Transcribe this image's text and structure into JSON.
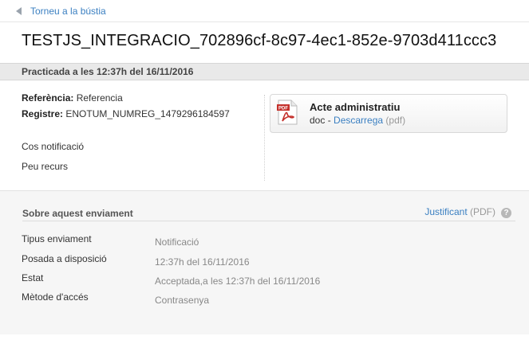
{
  "nav": {
    "back_label": "Torneu a la bústia"
  },
  "notification": {
    "title": "TESTJS_INTEGRACIO_702896cf-8c97-4ec1-852e-9703d411ccc3",
    "practicada": "Practicada a les 12:37h del 16/11/2016"
  },
  "details": {
    "referencia_label": "Referència:",
    "referencia_value": "Referencia",
    "registre_label": "Registre:",
    "registre_value": "ENOTUM_NUMREG_1479296184597",
    "cos": "Cos notificació",
    "peu": "Peu recurs"
  },
  "document": {
    "icon": "pdf-file-icon",
    "title": "Acte administratiu",
    "type": "doc",
    "separator": " - ",
    "download_label": "Descarrega",
    "format": " (pdf)"
  },
  "enviament": {
    "heading": "Sobre aquest enviament",
    "justificant_label": "Justificant",
    "justificant_format": " (PDF)",
    "help_icon": "help-icon",
    "help_glyph": "?",
    "rows": [
      {
        "label": "Tipus enviament",
        "value": "Notificació"
      },
      {
        "label": "Posada a disposició",
        "value": "12:37h del 16/11/2016"
      },
      {
        "label": "Estat",
        "value": "Acceptada,a les 12:37h del 16/11/2016"
      },
      {
        "label": "Mètode d'accés",
        "value": "Contrasenya"
      }
    ]
  },
  "colors": {
    "link": "#3a7fc1",
    "pdf_red": "#c4302b",
    "band": "#e9e9e9"
  }
}
